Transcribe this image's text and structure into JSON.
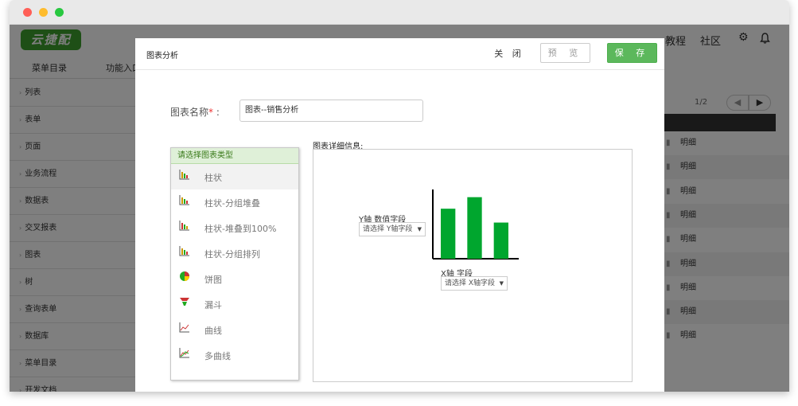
{
  "app": {
    "logo_text": "云捷配",
    "nav": [
      "教程",
      "社区"
    ],
    "sidebar_tabs": [
      "菜单目录",
      "功能入口"
    ],
    "sidebar_items": [
      "列表",
      "表单",
      "页面",
      "业务流程",
      "数据表",
      "交叉报表",
      "图表",
      "树",
      "查询表单",
      "数据库",
      "菜单目录",
      "开发文档"
    ],
    "pagination": "1/2",
    "row_action": "明细",
    "row_count": 9
  },
  "modal": {
    "title": "图表分析",
    "close_label": "关 闭",
    "preview_label": "预 览",
    "save_label": "保 存",
    "name_label": "图表名称",
    "name_required_mark": "*",
    "name_colon": ":",
    "name_value": "图表--销售分析",
    "type_header": "请选择图表类型",
    "chart_types": [
      {
        "label": "柱状",
        "icon": "bar-chart-icon"
      },
      {
        "label": "柱状-分组堆叠",
        "icon": "stacked-bar-icon"
      },
      {
        "label": "柱状-堆叠到100%",
        "icon": "percent-bar-icon"
      },
      {
        "label": "柱状-分组排列",
        "icon": "grouped-bar-icon"
      },
      {
        "label": "饼图",
        "icon": "pie-chart-icon"
      },
      {
        "label": "漏斗",
        "icon": "funnel-icon"
      },
      {
        "label": "曲线",
        "icon": "line-chart-icon"
      },
      {
        "label": "多曲线",
        "icon": "multi-line-icon"
      }
    ],
    "selected_type_index": 0,
    "detail_label": "图表详细信息:",
    "y_axis_label": "Y轴 数值字段",
    "y_select": "请选择 Y轴字段",
    "x_axis_label": "X轴 字段",
    "x_select": "请选择 X轴字段"
  },
  "chart_data": {
    "type": "bar",
    "categories": [
      "",
      "",
      ""
    ],
    "values": [
      65,
      80,
      47
    ],
    "ylim": [
      0,
      90
    ],
    "bar_color": "#00a62e",
    "grid": false
  },
  "colors": {
    "save": "#5cb85c",
    "accent_green": "#00a62e"
  }
}
